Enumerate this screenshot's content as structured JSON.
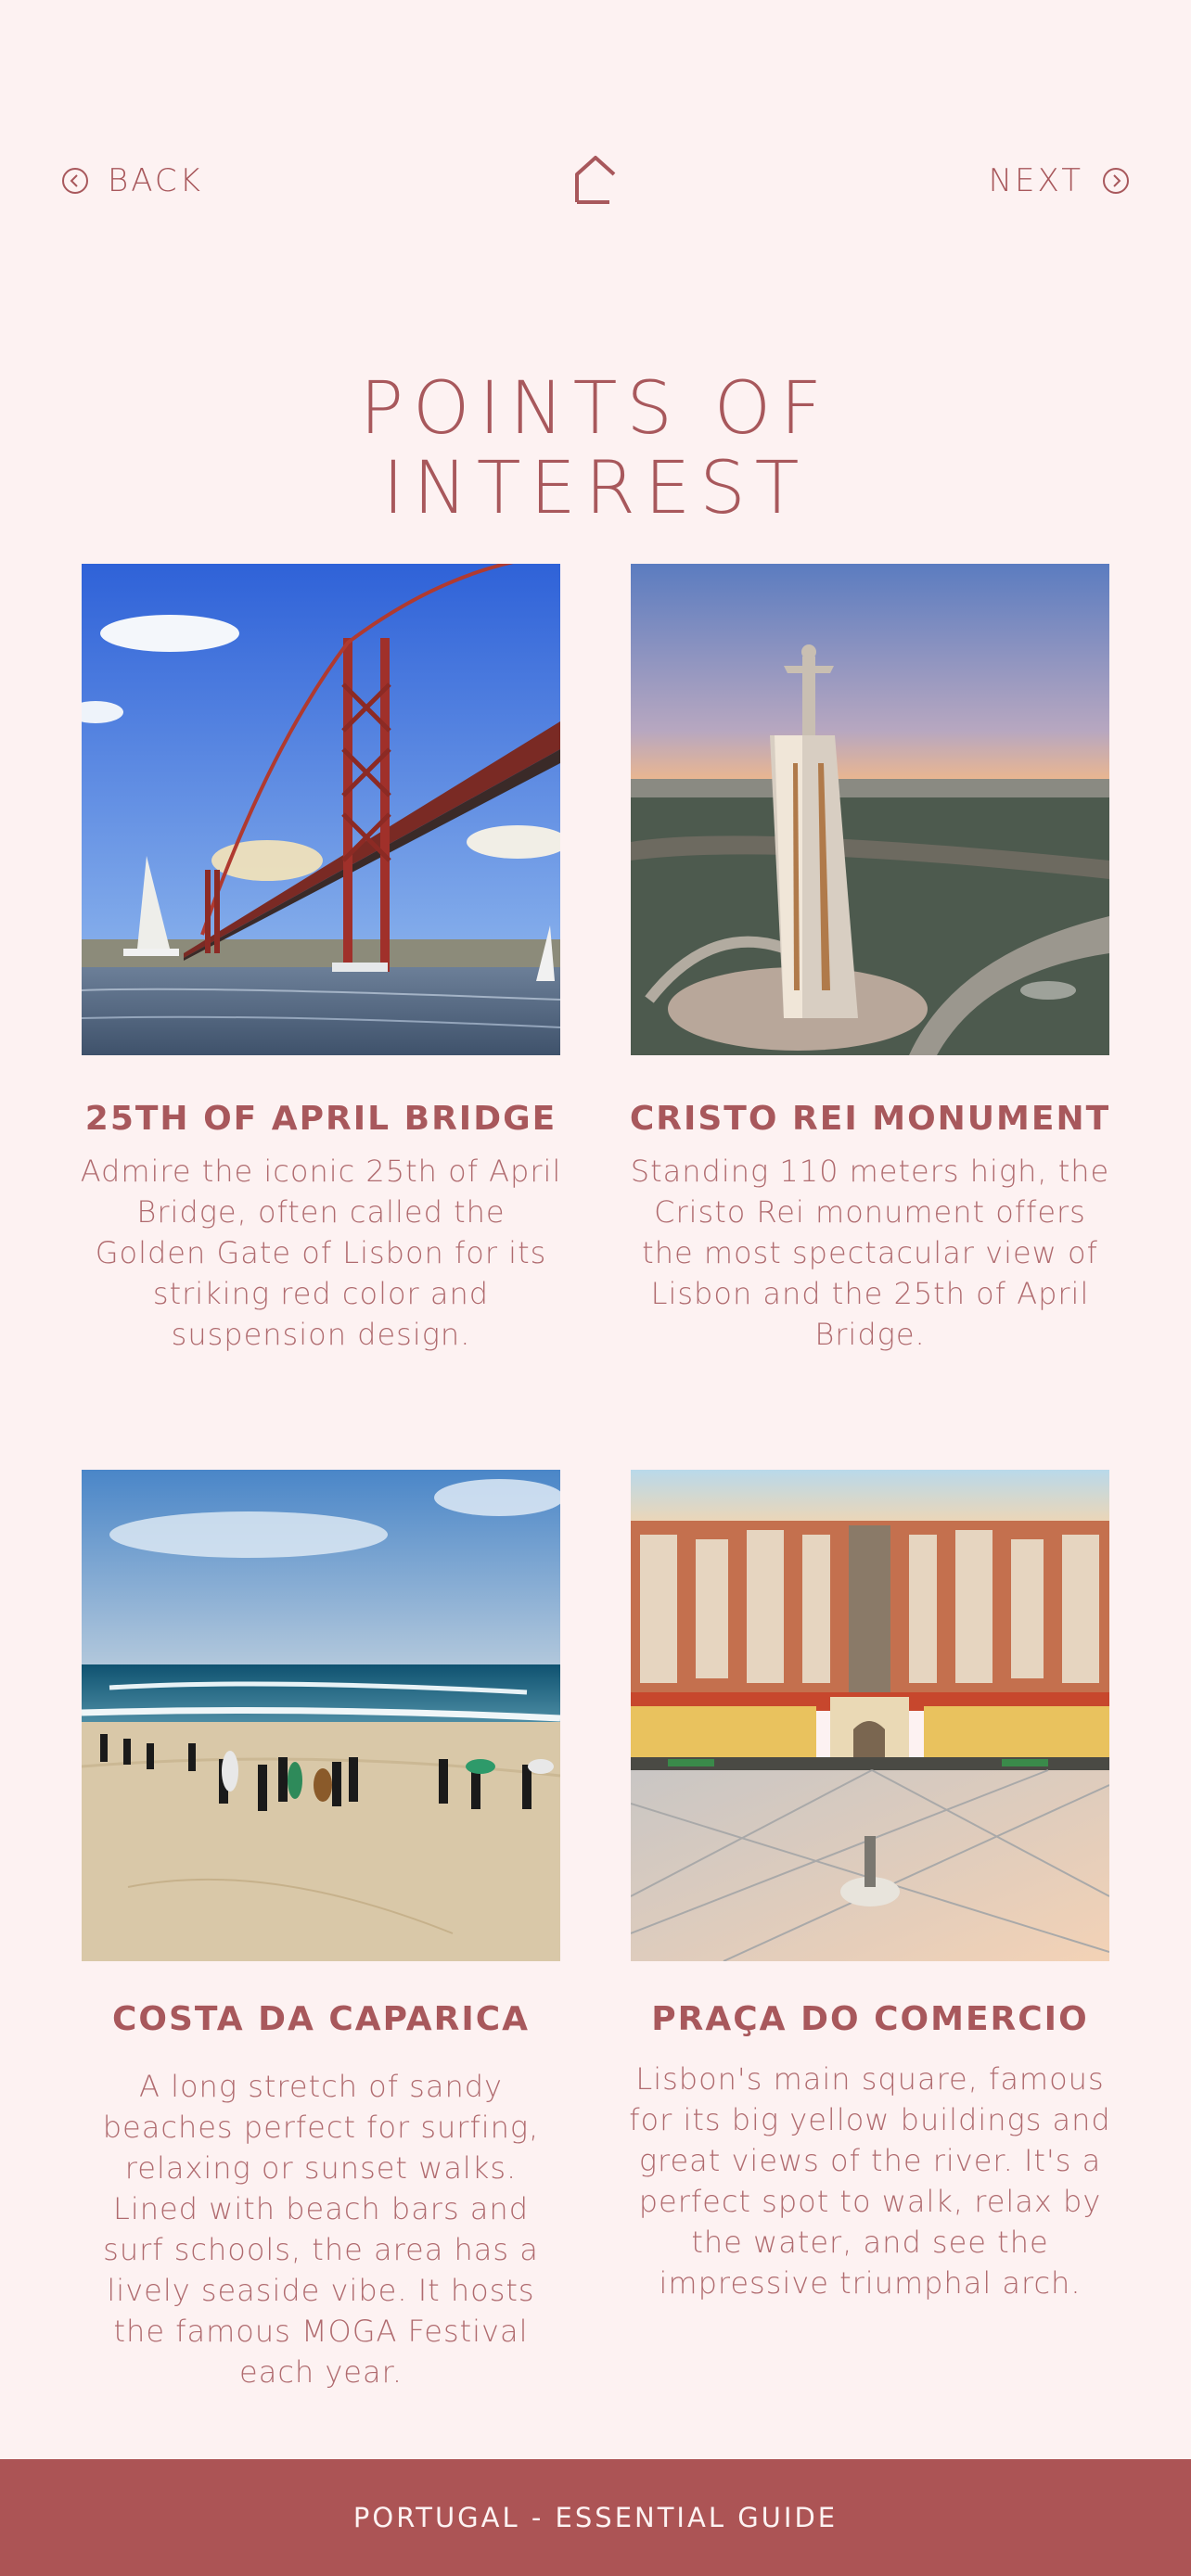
{
  "nav": {
    "back_label": "BACK",
    "next_label": "NEXT"
  },
  "title": {
    "line1": "POINTS OF",
    "line2": "INTEREST"
  },
  "cards": [
    {
      "title": "25TH OF APRIL BRIDGE",
      "description": "Admire the iconic 25th of April Bridge, often called the Golden Gate of Lisbon for its striking red color and suspension design."
    },
    {
      "title": "CRISTO REI MONUMENT",
      "description": "Standing 110 meters high, the Cristo Rei monument offers the most spectacular view of Lisbon and the 25th of April Bridge."
    },
    {
      "title": "COSTA DA CAPARICA",
      "description": "A long stretch of sandy beaches perfect for surfing, relaxing or sunset walks. Lined with beach bars and surf schools, the area has a lively seaside vibe. It hosts the famous MOGA Festival each year."
    },
    {
      "title": "PRAÇA DO COMERCIO",
      "description": "Lisbon's main square, famous for its big yellow buildings and great views of the river. It's a perfect spot to walk, relax by the water, and see the impressive triumphal arch."
    }
  ],
  "footer": {
    "text": "PORTUGAL - ESSENTIAL GUIDE"
  },
  "colors": {
    "background": "#fdf2f2",
    "accent": "#a8585c",
    "footer": "#ac5455"
  }
}
